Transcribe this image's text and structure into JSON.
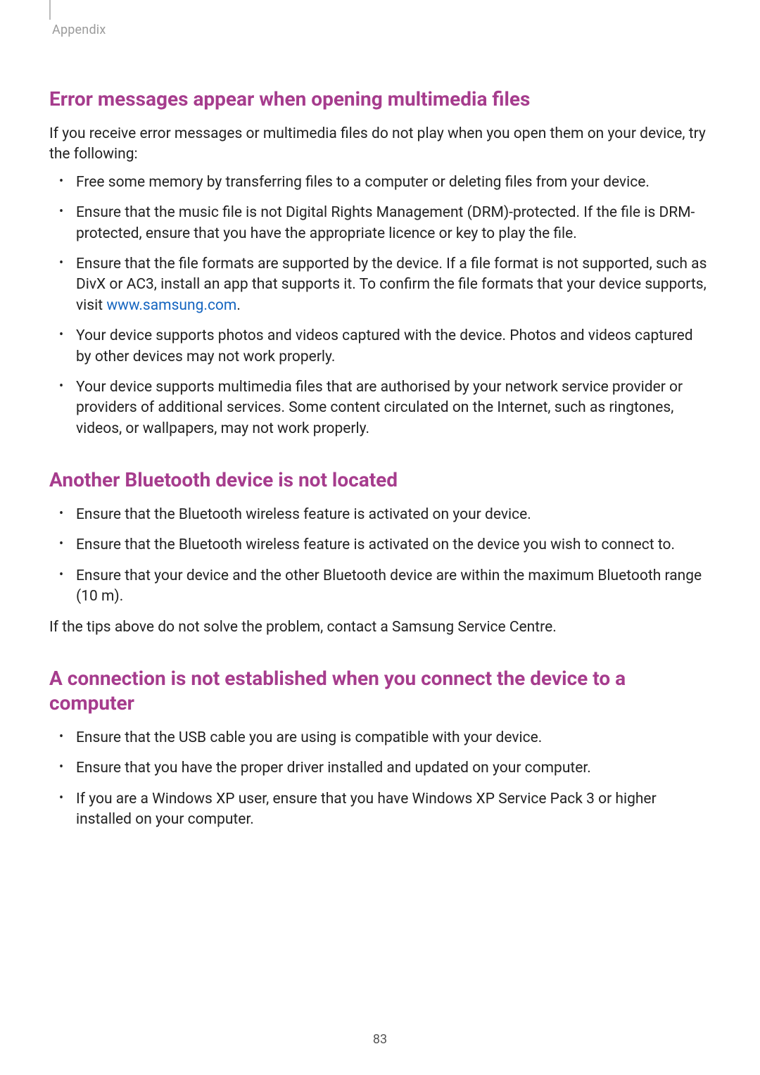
{
  "header": {
    "label": "Appendix"
  },
  "sections": [
    {
      "title": "Error messages appear when opening multimedia files",
      "intro": "If you receive error messages or multimedia files do not play when you open them on your device, try the following:",
      "bullets": [
        {
          "text": "Free some memory by transferring files to a computer or deleting files from your device."
        },
        {
          "text": "Ensure that the music file is not Digital Rights Management (DRM)-protected. If the file is DRM-protected, ensure that you have the appropriate licence or key to play the file."
        },
        {
          "pre": "Ensure that the file formats are supported by the device. If a file format is not supported, such as DivX or AC3, install an app that supports it. To confirm the file formats that your device supports, visit ",
          "link": "www.samsung.com",
          "post": "."
        },
        {
          "text": "Your device supports photos and videos captured with the device. Photos and videos captured by other devices may not work properly."
        },
        {
          "text": "Your device supports multimedia files that are authorised by your network service provider or providers of additional services. Some content circulated on the Internet, such as ringtones, videos, or wallpapers, may not work properly."
        }
      ]
    },
    {
      "title": "Another Bluetooth device is not located",
      "bullets": [
        {
          "text": "Ensure that the Bluetooth wireless feature is activated on your device."
        },
        {
          "text": "Ensure that the Bluetooth wireless feature is activated on the device you wish to connect to."
        },
        {
          "text": "Ensure that your device and the other Bluetooth device are within the maximum Bluetooth range (10 m)."
        }
      ],
      "outro": "If the tips above do not solve the problem, contact a Samsung Service Centre."
    },
    {
      "title": "A connection is not established when you connect the device to a computer",
      "bullets": [
        {
          "text": "Ensure that the USB cable you are using is compatible with your device."
        },
        {
          "text": "Ensure that you have the proper driver installed and updated on your computer."
        },
        {
          "text": "If you are a Windows XP user, ensure that you have Windows XP Service Pack 3 or higher installed on your computer."
        }
      ]
    }
  ],
  "page_number": "83"
}
